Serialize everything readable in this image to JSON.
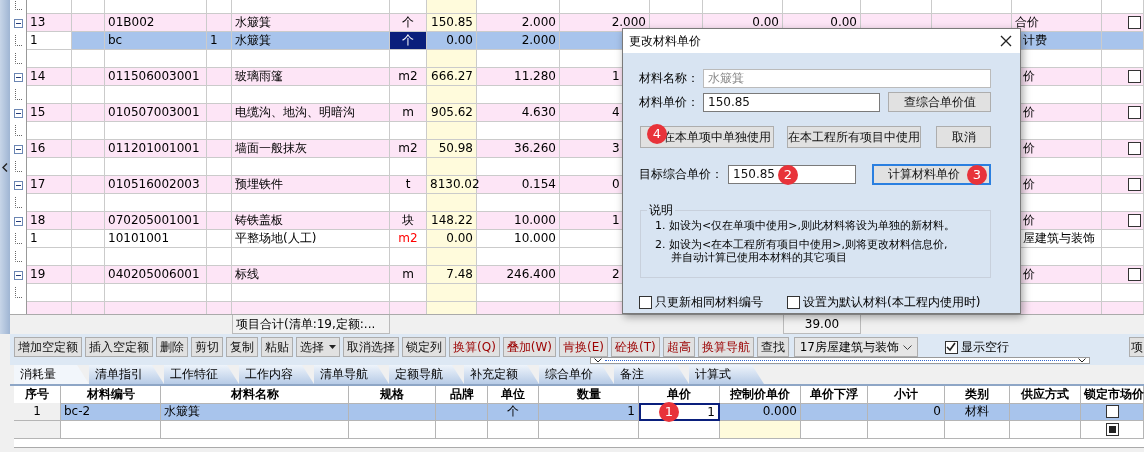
{
  "grid": {
    "rows": [
      {
        "kind": "blank",
        "selected": false
      },
      {
        "kind": "item",
        "expanded": true,
        "no": "13",
        "code": "01B002",
        "name": "水簸箕",
        "unit": "个",
        "price": "150.85",
        "qty": "2.000",
        "col_9": "2.000",
        "col_11": "0.00",
        "col_12": "0.00",
        "col_15": "合价",
        "checked": false,
        "covered": false,
        "selected": false
      },
      {
        "kind": "sub",
        "no": "1",
        "code": "bc",
        "col_4": "1",
        "name": "水簸箕",
        "unit": "个",
        "price": "0.00",
        "qty": "2.000",
        "col_15": "计费",
        "warning": false,
        "covered": true,
        "selected": true
      },
      {
        "kind": "blank",
        "selected": false
      },
      {
        "kind": "item",
        "expanded": true,
        "no": "14",
        "code": "011506003001",
        "name": "玻璃雨篷",
        "unit": "m2",
        "price": "666.27",
        "qty": "11.280",
        "col_9": "1",
        "col_15": "价",
        "checked": false,
        "covered": true,
        "selected": false
      },
      {
        "kind": "blank",
        "selected": false
      },
      {
        "kind": "item",
        "expanded": true,
        "no": "15",
        "code": "010507003001",
        "name": "电缆沟、地沟、明暗沟",
        "unit": "m",
        "price": "905.62",
        "qty": "4.630",
        "col_9": "4",
        "col_15": "价",
        "checked": false,
        "covered": true,
        "selected": false
      },
      {
        "kind": "blank",
        "selected": false
      },
      {
        "kind": "item",
        "expanded": true,
        "no": "16",
        "code": "011201001001",
        "name": "墙面一般抹灰",
        "unit": "m2",
        "price": "50.98",
        "qty": "36.260",
        "col_9": "3",
        "col_15": "价",
        "checked": false,
        "covered": true,
        "selected": false
      },
      {
        "kind": "blank",
        "selected": false
      },
      {
        "kind": "item",
        "expanded": true,
        "no": "17",
        "code": "010516002003",
        "name": "预埋铁件",
        "unit": "t",
        "price": "8130.02",
        "qty": "0.154",
        "col_9": "0",
        "col_15": "价",
        "checked": false,
        "covered": true,
        "selected": false
      },
      {
        "kind": "blank",
        "selected": false
      },
      {
        "kind": "item",
        "expanded": true,
        "no": "18",
        "code": "070205001001",
        "name": "铸铁盖板",
        "unit": "块",
        "price": "148.22",
        "qty": "10.000",
        "col_9": "1",
        "col_15": "价",
        "checked": false,
        "covered": true,
        "selected": false
      },
      {
        "kind": "sub",
        "no": "1",
        "code": "10101001",
        "name": "平整场地(人工)",
        "unit": "m2",
        "price": "0.00",
        "qty": "10.000",
        "col_15": "屋建筑与装饰",
        "warning": true,
        "covered": true,
        "selected": false
      },
      {
        "kind": "blank",
        "selected": false
      },
      {
        "kind": "item",
        "expanded": true,
        "no": "19",
        "code": "040205006001",
        "name": "标线",
        "unit": "m",
        "price": "7.48",
        "qty": "246.400",
        "col_9": "2",
        "col_15": "价",
        "checked": false,
        "covered": true,
        "selected": false
      },
      {
        "kind": "blank",
        "selected": false
      },
      {
        "kind": "item",
        "selected": false
      }
    ]
  },
  "summary": {
    "label": "项目合计(清单:19,定额:...",
    "total": "39.00"
  },
  "toolbar": [
    {
      "kind": "button",
      "label": "增加空定额",
      "highlight": false
    },
    {
      "kind": "button",
      "label": "插入空定额",
      "highlight": false
    },
    {
      "kind": "button",
      "label": "删除",
      "highlight": false
    },
    {
      "kind": "button",
      "label": "剪切",
      "highlight": false
    },
    {
      "kind": "button",
      "label": "复制",
      "highlight": false
    },
    {
      "kind": "button",
      "label": "粘贴",
      "highlight": false
    },
    {
      "kind": "dropdown",
      "label": "选择",
      "highlight": false
    },
    {
      "kind": "button",
      "label": "取消选择",
      "highlight": false
    },
    {
      "kind": "button",
      "label": "锁定列",
      "highlight": false
    },
    {
      "kind": "button",
      "label": "换算(Q)",
      "highlight": true
    },
    {
      "kind": "button",
      "label": "叠加(W)",
      "highlight": true
    },
    {
      "kind": "button",
      "label": "肯换(E)",
      "highlight": true
    },
    {
      "kind": "button",
      "label": "砼换(T)",
      "highlight": true
    },
    {
      "kind": "button",
      "label": "超高",
      "highlight": true
    },
    {
      "kind": "button",
      "label": "换算导航",
      "highlight": true
    },
    {
      "kind": "button",
      "label": "查找",
      "highlight": false
    },
    {
      "kind": "combo",
      "label": "17房屋建筑与装饰"
    },
    {
      "kind": "checkbox",
      "label": "显示空行",
      "checked": true
    },
    {
      "kind": "edge",
      "label": "项",
      "highlight": false
    }
  ],
  "tabs": [
    {
      "label": "消耗量",
      "selected": true
    },
    {
      "label": "清单指引",
      "selected": false
    },
    {
      "label": "工作特征",
      "selected": false
    },
    {
      "label": "工作内容",
      "selected": false
    },
    {
      "label": "清单导航",
      "selected": false
    },
    {
      "label": "定额导航",
      "selected": false
    },
    {
      "label": "补充定额",
      "selected": false
    },
    {
      "label": "综合单价",
      "selected": false
    },
    {
      "label": "备注",
      "selected": false
    },
    {
      "label": "计算式",
      "selected": false
    }
  ],
  "materials": {
    "columns": [
      "序号",
      "材料编号",
      "材料名称",
      "规格",
      "品牌",
      "单位",
      "数量",
      "单价",
      "控制价单价",
      "单价下浮",
      "小计",
      "类别",
      "供应方式",
      "锁定市场价"
    ],
    "rows": [
      {
        "no": "1",
        "code": "bc-2",
        "name": "水簸箕",
        "unit": "个",
        "qty": "1",
        "price": "1",
        "control_price": "0.000",
        "subtotal": "0",
        "category": "材料",
        "editing": true,
        "badge": "1",
        "locked": false,
        "selected": true
      },
      {
        "editing": false,
        "locked": true,
        "selected": false
      }
    ]
  },
  "dialog": {
    "title": "更改材料单价",
    "fields": [
      {
        "label": "材料名称：",
        "value": "水簸箕",
        "disabled": true
      },
      {
        "label": "材料单价：",
        "value": "150.85",
        "disabled": false
      }
    ],
    "lookup_button": "查综合单价值",
    "actions": [
      {
        "label": "在本单项中单独使用",
        "badge": "4"
      },
      {
        "label": "在本工程所有项目中使用"
      },
      {
        "label": "取消"
      }
    ],
    "target": {
      "label": "目标综合单价：",
      "value": "150.85",
      "badge": "2"
    },
    "calc_button": {
      "label": "计算材料单价",
      "badge": "3",
      "focused": true
    },
    "notes": {
      "title": "说明",
      "lines": [
        "1. 如设为<仅在单项中使用>,则此材料将设为单独的新材料。",
        "2. 如设为<在本工程所有项目中使用>,则将更改材料信息价,\n并自动计算已使用本材料的其它项目"
      ]
    },
    "options": [
      {
        "label": "只更新相同材料编号",
        "checked": false
      },
      {
        "label": "设置为默认材料(本工程内使用时)",
        "checked": false
      }
    ]
  }
}
